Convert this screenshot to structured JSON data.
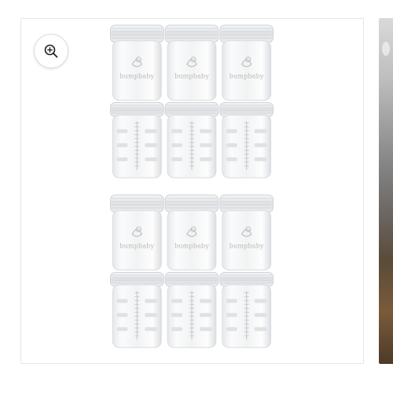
{
  "gallery": {
    "zoom": {
      "icon": "zoom-in-icon"
    },
    "product": {
      "brand_embossed": "bumpbaby",
      "jar_rows": 4,
      "jars_per_row": 3
    }
  },
  "colors": {
    "background": "#ffffff",
    "frame_border": "#e6e6e6",
    "jar_glass": "#f4f5f6",
    "jar_lid": "#e9eaec"
  }
}
